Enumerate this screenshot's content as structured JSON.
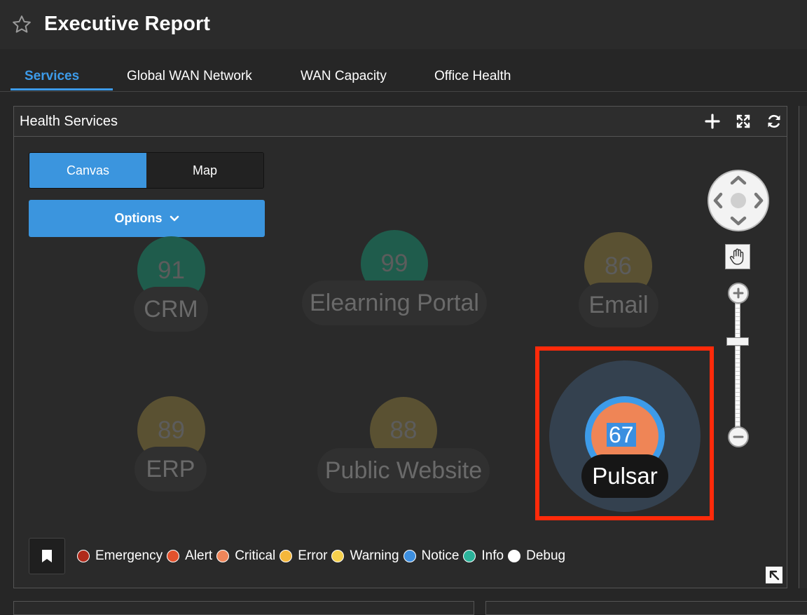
{
  "app": {
    "title": "Executive Report"
  },
  "tabs": [
    {
      "label": "Services"
    },
    {
      "label": "Global WAN Network"
    },
    {
      "label": "WAN Capacity"
    },
    {
      "label": "Office Health"
    }
  ],
  "panel": {
    "title": "Health Services",
    "header_icons": [
      "plus-icon",
      "expand-arrows-icon",
      "refresh-icon"
    ]
  },
  "view_toggle": {
    "canvas": "Canvas",
    "map": "Map",
    "selected": "Canvas"
  },
  "options_button": {
    "label": "Options"
  },
  "services": [
    {
      "name": "CRM",
      "score": "91",
      "color": "#1f5c4c"
    },
    {
      "name": "Elearning Portal",
      "score": "99",
      "color": "#1f5c4c"
    },
    {
      "name": "Email",
      "score": "86",
      "color": "#5a5132"
    },
    {
      "name": "ERP",
      "score": "89",
      "color": "#5a5132"
    },
    {
      "name": "Public Website",
      "score": "88",
      "color": "#5a5132"
    },
    {
      "name": "Pulsar",
      "score": "67",
      "color": "#ef8556",
      "selected": true
    }
  ],
  "legend": [
    {
      "label": "Emergency",
      "color": "#b02a1b"
    },
    {
      "label": "Alert",
      "color": "#e2512c"
    },
    {
      "label": "Critical",
      "color": "#f0865a"
    },
    {
      "label": "Error",
      "color": "#f5b73b"
    },
    {
      "label": "Warning",
      "color": "#f6d04d"
    },
    {
      "label": "Notice",
      "color": "#3d8fe0"
    },
    {
      "label": "Info",
      "color": "#2bb39a"
    },
    {
      "label": "Debug",
      "color": "#ffffff"
    }
  ],
  "colors": {
    "accent": "#3b95de",
    "highlight": "#ff2a0a"
  }
}
